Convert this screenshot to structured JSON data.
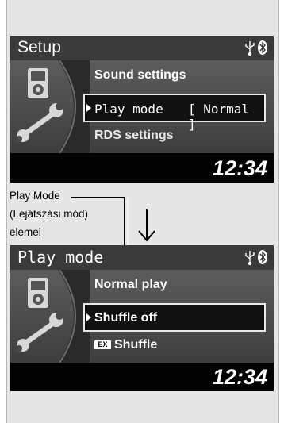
{
  "screen1": {
    "title": "Setup",
    "items": [
      {
        "label": "Sound settings"
      },
      {
        "label": "Play mode",
        "value": "[ Normal ]"
      },
      {
        "label": "RDS settings"
      }
    ],
    "time": "12:34"
  },
  "caption": {
    "line1": "Play Mode",
    "line2": "(Lejátszási mód)",
    "line3": "elemei"
  },
  "screen2": {
    "title": "Play mode",
    "items": [
      {
        "label": "Normal play"
      },
      {
        "label": "Shuffle off"
      },
      {
        "label": "Shuffle",
        "badge": "EX"
      }
    ],
    "time": "12:34"
  },
  "icons": [
    "usb-icon",
    "bluetooth-icon",
    "ipod-icon",
    "wrench-icon",
    "selection-arrow-icon",
    "down-arrow-icon"
  ],
  "colors": {
    "screen_bg": "#000000",
    "titlebar": "#3a3a3a",
    "highlight_border": "#e9e9e9",
    "text": "#ffffff"
  }
}
